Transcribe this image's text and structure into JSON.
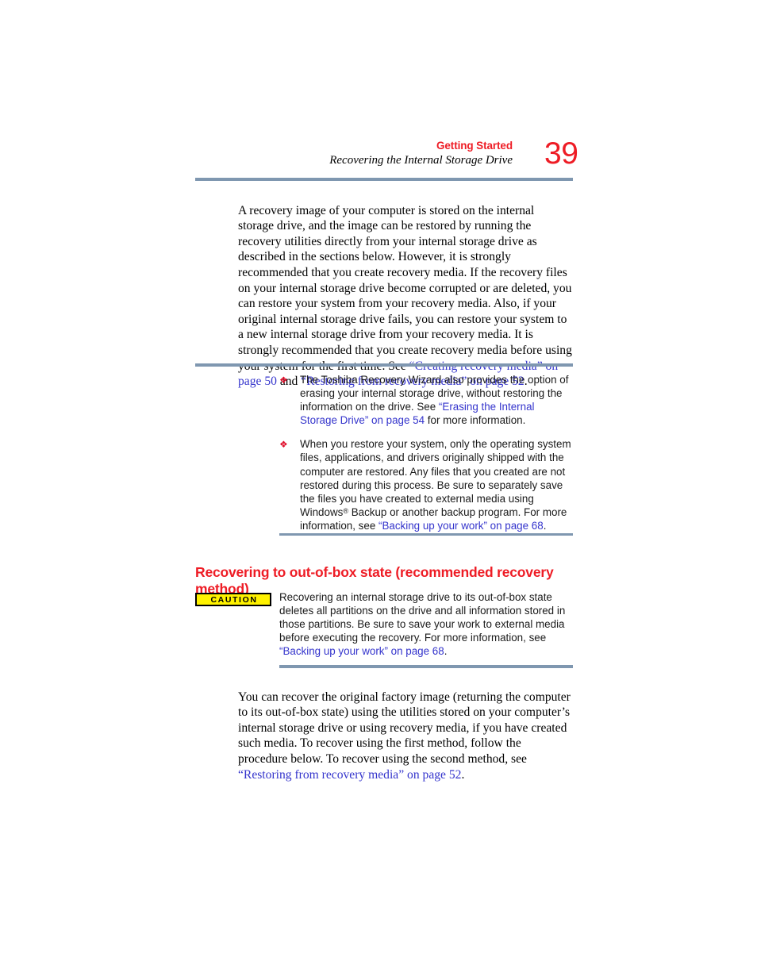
{
  "header": {
    "chapter": "Getting Started",
    "section": "Recovering the Internal Storage Drive",
    "page_number": "39"
  },
  "colors": {
    "accent_red": "#ee1c25",
    "rule_blue_gray": "#7f97b0",
    "link_blue": "#3434cc",
    "caution_yellow": "#fff200"
  },
  "intro_paragraph": {
    "text_1": "A recovery image of your computer is stored on the internal storage drive, and the image can be restored by running the recovery utilities directly from your internal storage drive as described in the sections below. However, it is strongly recommended that you create recovery media. If the recovery files on your internal storage drive become corrupted or are deleted, you can restore your system from your recovery media. Also, if your original internal storage drive fails, you can restore your system to a new internal storage drive from your recovery media. It is strongly recommended that you create recovery media before using your system for the first time. See ",
    "link_1": "“Creating recovery media” on page 50",
    "text_2": " and ",
    "link_2": "“Restoring from recovery media” on page 52",
    "text_3": "."
  },
  "bullets": {
    "marker_glyph": "❖",
    "items": [
      {
        "text_1": "The Toshiba Recovery Wizard also provides the option of erasing your internal storage drive, without restoring the information on the drive. See ",
        "link_1": "“Erasing the Internal Storage Drive” on page 54",
        "text_2": " for more information."
      },
      {
        "text_1": "When you restore your system, only the operating system files, applications, and drivers originally shipped with the computer are restored. Any files that you created are not restored during this process. Be sure to separately save the files you have created to external media using Windows",
        "superscript": "®",
        "text_2": " Backup or another backup program. For more information, see ",
        "link_1": "“Backing up your work” on page 68",
        "text_3": "."
      }
    ]
  },
  "section_heading": {
    "title": "Recovering to out-of-box state (recommended recovery method)"
  },
  "caution": {
    "badge_label": "CAUTION",
    "text_1": "Recovering an internal storage drive to its out-of-box state deletes all partitions on the drive and all information stored in those partitions. Be sure to save your work to external media before executing the recovery. For more information, see ",
    "link_1": "“Backing up your work” on page 68",
    "text_2": "."
  },
  "outro_paragraph": {
    "text_1": "You can recover the original factory image (returning the computer to its out-of-box state) using the utilities stored on your computer’s internal storage drive or using recovery media, if you have created such media. To recover using the first method, follow the procedure below. To recover using the second method, see ",
    "link_1": "“Restoring from recovery media” on page 52",
    "text_2": "."
  }
}
